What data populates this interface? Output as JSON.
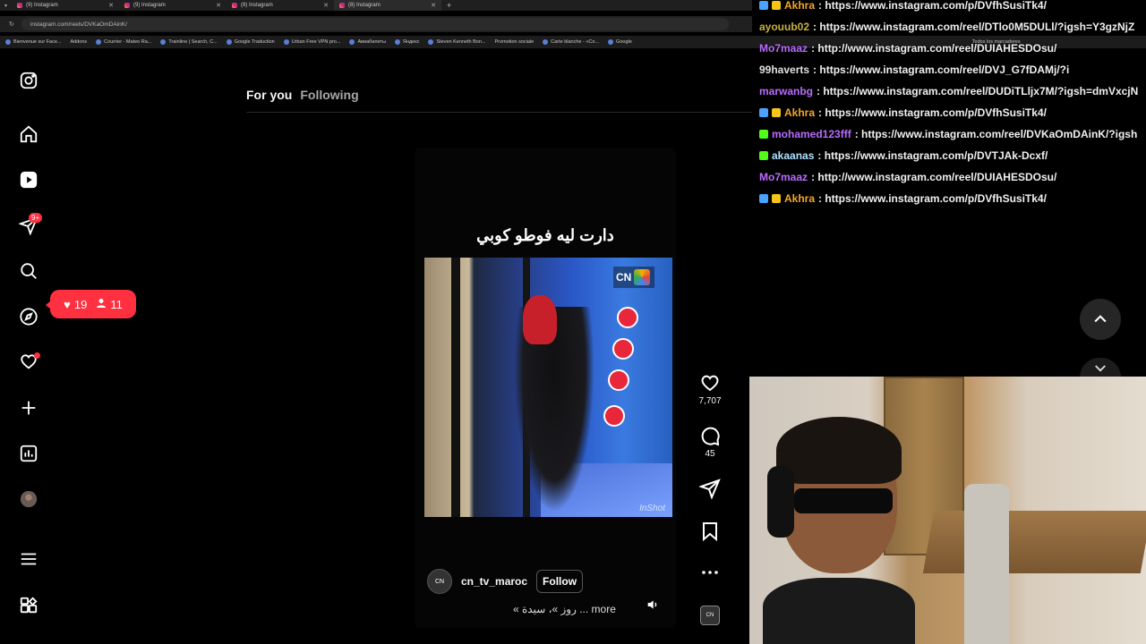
{
  "browser": {
    "tabs": [
      {
        "label": "(9) Instagram"
      },
      {
        "label": "(9) Instagram"
      },
      {
        "label": "(8) Instagram"
      },
      {
        "label": "(8) Instagram"
      }
    ],
    "url": "instagram.com/reels/DVKaOmDAinK/",
    "bookmarks": [
      "Bienvenue sur Face...",
      "Addons",
      "Courrier - Mateo Ra...",
      "Trainline | Search, C...",
      "Google Traduction",
      "Urban Free VPN pro...",
      "Авиабилеты",
      "Яндекс",
      "Steven Kenneth Bon...",
      "Promotion sociale",
      "Carte blanche - «Co...",
      "Google",
      "Todos los marcadores"
    ]
  },
  "nav": {
    "messages_badge": "9+",
    "notifications": {
      "likes": "19",
      "follows": "11"
    }
  },
  "feed": {
    "tab_for_you": "For you",
    "tab_following": "Following"
  },
  "reel": {
    "overlay_text": "دارت ليه فوطو كوبي",
    "watermark_brand": "CN",
    "watermark_app": "InShot",
    "username": "cn_tv_maroc",
    "follow_label": "Follow",
    "avatar_text": "CN",
    "description": "« روز »، سيدة ... more",
    "likes": "7,707",
    "comments": "45"
  },
  "chat": [
    {
      "user": "Akhra",
      "msg": ": https://www.instagram.com/p/DVfhSusiTk4/",
      "color": "#f5a623",
      "icons": [
        "#4aa3ff",
        "#f5c518"
      ]
    },
    {
      "user": "ayouub02",
      "msg": ": https://www.instagram.com/reel/DTlo0M5DULl/?igsh=Y3gzNjZ",
      "color": "#c7b042",
      "icons": []
    },
    {
      "user": "Mo7maaz",
      "msg": ": http://www.instagram.com/reel/DUIAHESDOsu/",
      "color": "#b96bff",
      "icons": []
    },
    {
      "user": "99haverts",
      "msg": ": https://www.instagram.com/reel/DVJ_G7fDAMj/?i",
      "color": "#e0e0e0",
      "icons": []
    },
    {
      "user": "marwanbg",
      "msg": ": https://www.instagram.com/reel/DUDiTLljx7M/?igsh=dmVxcjN",
      "color": "#b96bff",
      "icons": []
    },
    {
      "user": "Akhra",
      "msg": ": https://www.instagram.com/p/DVfhSusiTk4/",
      "color": "#f5a623",
      "icons": [
        "#4aa3ff",
        "#f5c518"
      ]
    },
    {
      "user": "mohamed123fff",
      "msg": ": https://www.instagram.com/reel/DVKaOmDAinK/?igsh",
      "color": "#b96bff",
      "icons": [
        "#53fc18"
      ]
    },
    {
      "user": "akaanas",
      "msg": ": https://www.instagram.com/p/DVTJAk-Dcxf/",
      "color": "#aee0ff",
      "icons": [
        "#53fc18"
      ]
    },
    {
      "user": "Mo7maaz",
      "msg": ": http://www.instagram.com/reel/DUIAHESDOsu/",
      "color": "#b96bff",
      "icons": []
    },
    {
      "user": "Akhra",
      "msg": ": https://www.instagram.com/p/DVfhSusiTk4/",
      "color": "#f5a623",
      "icons": [
        "#4aa3ff",
        "#f5c518"
      ]
    }
  ],
  "colors": {
    "accent_red": "#ff3040",
    "background": "#000000"
  }
}
